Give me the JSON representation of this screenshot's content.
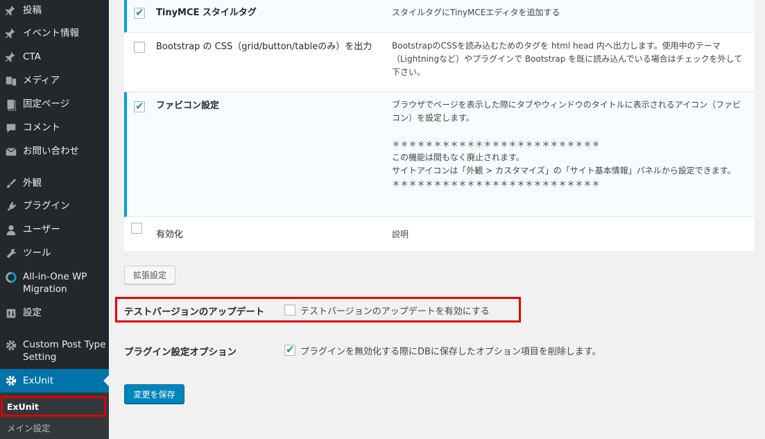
{
  "sidebar": {
    "items": [
      {
        "label": "投稿",
        "icon": "pin-icon"
      },
      {
        "label": "イベント情報",
        "icon": "pin-icon"
      },
      {
        "label": "CTA",
        "icon": "pin-icon"
      },
      {
        "label": "メディア",
        "icon": "media-icon"
      },
      {
        "label": "固定ページ",
        "icon": "page-icon"
      },
      {
        "label": "コメント",
        "icon": "comment-icon"
      },
      {
        "label": "お問い合わせ",
        "icon": "mail-icon"
      },
      {
        "label": "外観",
        "icon": "brush-icon"
      },
      {
        "label": "プラグイン",
        "icon": "plugin-icon"
      },
      {
        "label": "ユーザー",
        "icon": "user-icon"
      },
      {
        "label": "ツール",
        "icon": "wrench-icon"
      },
      {
        "label": "All-in-One WP Migration",
        "icon": "migration-icon"
      },
      {
        "label": "設定",
        "icon": "settings-icon"
      },
      {
        "label": "Custom Post Type Setting",
        "icon": "gear-icon"
      },
      {
        "label": "ExUnit",
        "icon": "gear-icon"
      }
    ],
    "submenu": [
      {
        "label": "ExUnit"
      },
      {
        "label": "メイン設定"
      }
    ]
  },
  "table": {
    "rows": [
      {
        "name": "TinyMCE スタイルタグ",
        "checked": true,
        "desc": "スタイルタグにTinyMCEエディタを追加する"
      },
      {
        "name": "Bootstrap の CSS（grid/button/tableのみ）を出力",
        "checked": false,
        "desc": "BootstrapのCSSを読み込むためのタグを html head 内へ出力します。使用中のテーマ（Lightningなど）やプラグインで Bootstrap を既に読み込んでいる場合はチェックを外して下さい。"
      },
      {
        "name": "ファビコン設定",
        "checked": true,
        "desc": "ブラウザでページを表示した際にタブやウィンドウのタイトルに表示されるアイコン（ファビコン）を設定します。\n\n＊＊＊＊＊＊＊＊＊＊＊＊＊＊＊＊＊＊＊＊＊＊＊＊＊\nこの機能は間もなく廃止されます。\nサイトアイコンは「外観 > カスタマイズ」の「サイト基本情報」パネルから設定できます。\n＊＊＊＊＊＊＊＊＊＊＊＊＊＊＊＊＊＊＊＊＊＊＊＊＊"
      },
      {
        "name": "有効化",
        "checked": false,
        "desc": "説明"
      }
    ]
  },
  "buttons": {
    "extended": "拡張設定",
    "save": "変更を保存"
  },
  "options": {
    "test_version_label": "テストバージョンのアップデート",
    "test_version_text": "テストバージョンのアップデートを有効にする",
    "test_version_checked": false,
    "plugin_option_label": "プラグイン設定オプション",
    "plugin_option_text": "プラグインを無効化する際にDBに保存したオプション項目を削除します。",
    "plugin_option_checked": true
  },
  "colors": {
    "sidebar_bg": "#23282d",
    "active_bg": "#0073aa",
    "highlight": "#e00000",
    "check": "#1e8cbe"
  }
}
